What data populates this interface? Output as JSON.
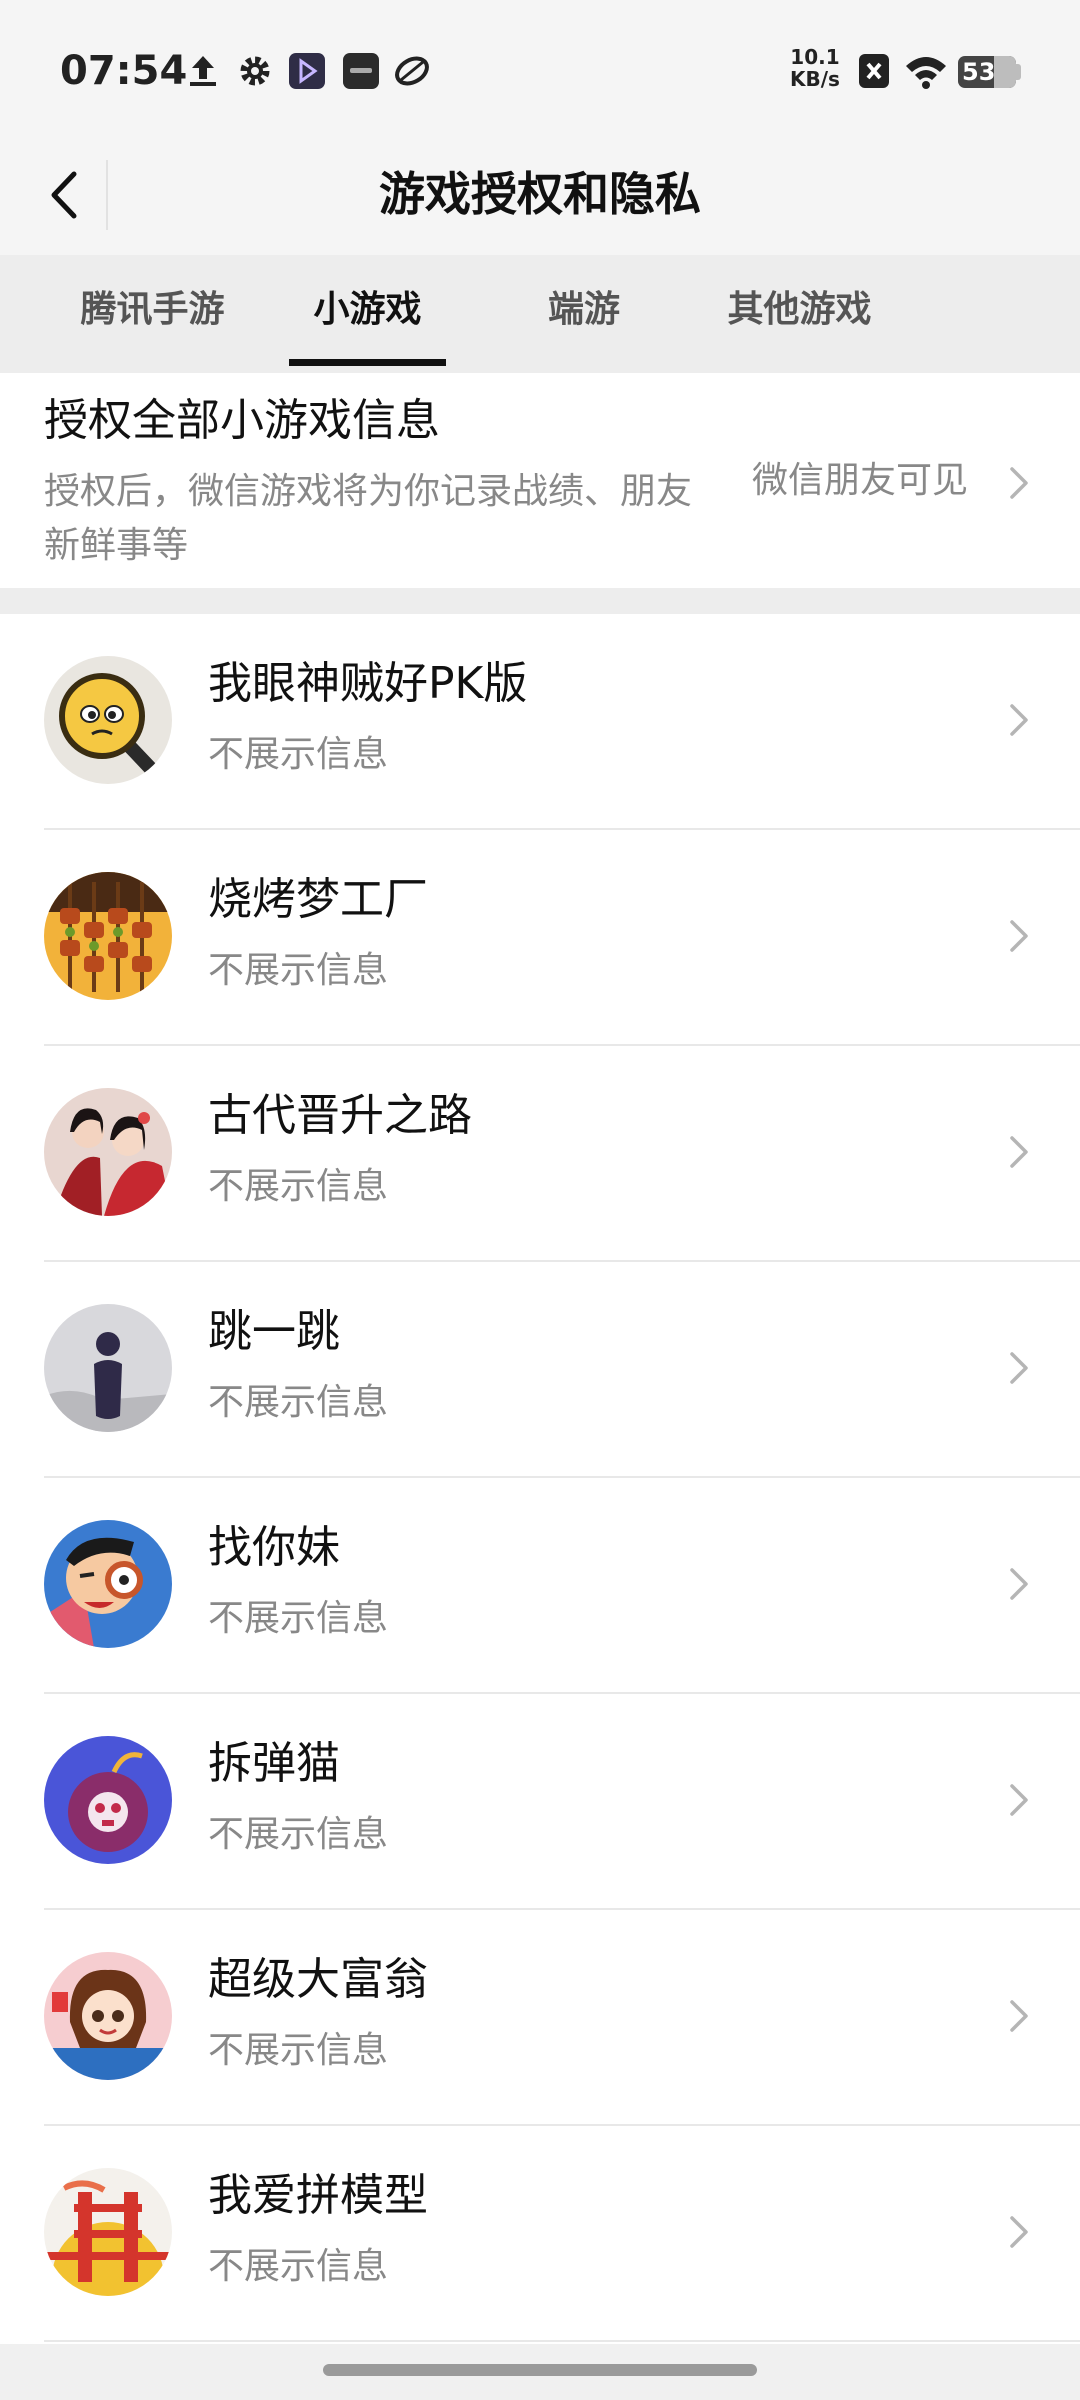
{
  "status_bar": {
    "time": "07:54",
    "net_speed_value": "10.1",
    "net_speed_unit": "KB/s",
    "battery": "53",
    "icons": [
      "upload-icon",
      "gear-icon",
      "video-app-icon",
      "vivo-app-icon",
      "leaf-app-icon",
      "x-notification-icon",
      "wifi-icon",
      "battery-icon"
    ]
  },
  "header": {
    "title": "游戏授权和隐私",
    "back_icon": "chevron-left-icon"
  },
  "tabs": [
    {
      "label": "腾讯手游",
      "active": false
    },
    {
      "label": "小游戏",
      "active": true
    },
    {
      "label": "端游",
      "active": false
    },
    {
      "label": "其他游戏",
      "active": false
    }
  ],
  "authorize_all": {
    "title": "授权全部小游戏信息",
    "description": "授权后，微信游戏将为你记录战绩、朋友新鲜事等",
    "visibility": "微信朋友可见"
  },
  "games": [
    {
      "name": "我眼神贼好PK版",
      "status": "不展示信息",
      "icon": "magnifier-face-icon"
    },
    {
      "name": "烧烤梦工厂",
      "status": "不展示信息",
      "icon": "skewers-icon"
    },
    {
      "name": "古代晋升之路",
      "status": "不展示信息",
      "icon": "ancient-couple-icon"
    },
    {
      "name": "跳一跳",
      "status": "不展示信息",
      "icon": "jump-piece-icon"
    },
    {
      "name": "找你妹",
      "status": "不展示信息",
      "icon": "cartoon-face-icon"
    },
    {
      "name": "拆弹猫",
      "status": "不展示信息",
      "icon": "bomb-cat-icon"
    },
    {
      "name": "超级大富翁",
      "status": "不展示信息",
      "icon": "cartoon-girl-icon"
    },
    {
      "name": "我爱拼模型",
      "status": "不展示信息",
      "icon": "bridge-model-icon"
    }
  ],
  "colors": {
    "background": "#ffffff",
    "header_bg": "#f5f5f5",
    "tab_bar_bg": "#ededed",
    "secondary_text": "#888888",
    "primary_text": "#111111"
  }
}
